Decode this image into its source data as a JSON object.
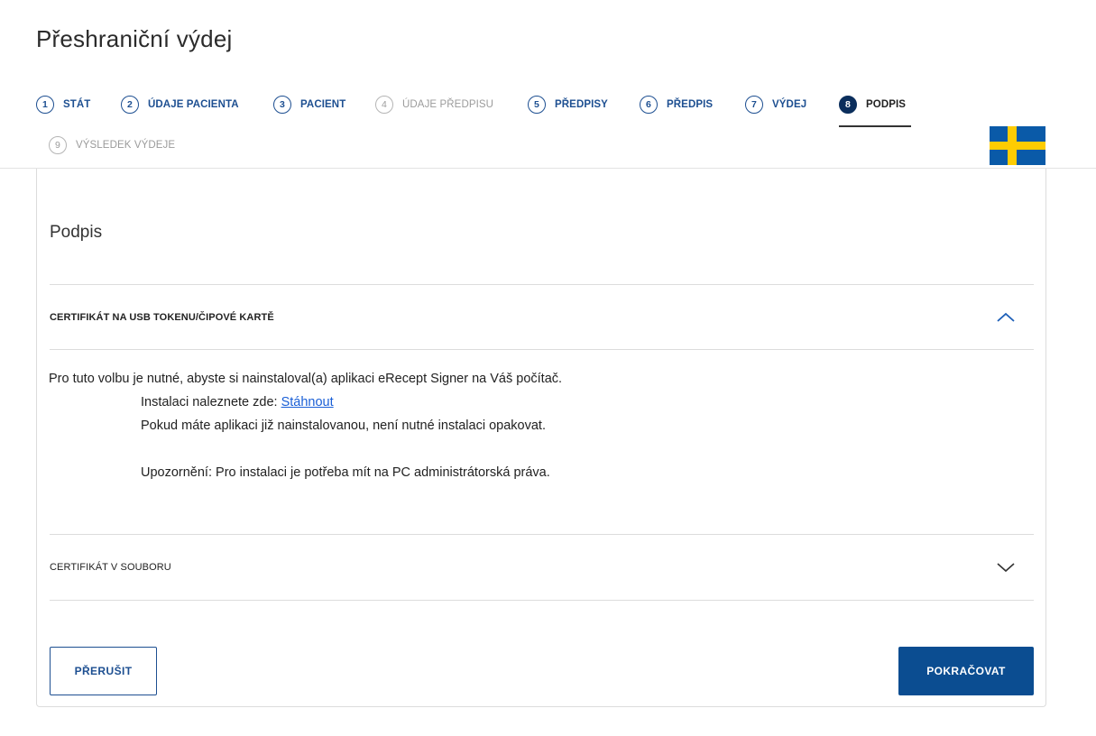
{
  "page": {
    "title": "Přeshraniční výdej"
  },
  "steps": [
    {
      "num": "1",
      "label": "STÁT",
      "state": "done"
    },
    {
      "num": "2",
      "label": "ÚDAJE PACIENTA",
      "state": "done"
    },
    {
      "num": "3",
      "label": "PACIENT",
      "state": "done"
    },
    {
      "num": "4",
      "label": "ÚDAJE PŘEDPISU",
      "state": "disabled"
    },
    {
      "num": "5",
      "label": "PŘEDPISY",
      "state": "done"
    },
    {
      "num": "6",
      "label": "PŘEDPIS",
      "state": "done"
    },
    {
      "num": "7",
      "label": "VÝDEJ",
      "state": "done"
    },
    {
      "num": "8",
      "label": "PODPIS",
      "state": "active"
    },
    {
      "num": "9",
      "label": "VÝSLEDEK VÝDEJE",
      "state": "disabled"
    }
  ],
  "flag": {
    "country": "Sweden",
    "colors": {
      "blue": "#0a5aa8",
      "yellow": "#fecc02"
    }
  },
  "card": {
    "title": "Podpis",
    "accordions": [
      {
        "label": "CERTIFIKÁT NA USB TOKENU/ČIPOVÉ KARTĚ",
        "expanded": true,
        "icon": "chevron-up-icon",
        "body": {
          "line1": "Pro tuto volbu je nutné, abyste si nainstaloval(a) aplikaci eRecept Signer na Váš počítač.",
          "line2_prefix": "Instalaci naleznete zde: ",
          "line2_link": "Stáhnout",
          "line3": "Pokud máte aplikaci již nainstalovanou, není nutné instalaci opakovat.",
          "line4": "Upozornění: Pro instalaci je potřeba mít na PC administrátorská práva."
        }
      },
      {
        "label": "CERTIFIKÁT V SOUBORU",
        "expanded": false,
        "icon": "chevron-down-icon"
      }
    ],
    "buttons": {
      "cancel": "PŘERUŠIT",
      "continue": "POKRAČOVAT"
    }
  },
  "colors": {
    "primary": "#0b4d91",
    "step_active": "#0b2e5c",
    "link": "#1a5fd6"
  }
}
